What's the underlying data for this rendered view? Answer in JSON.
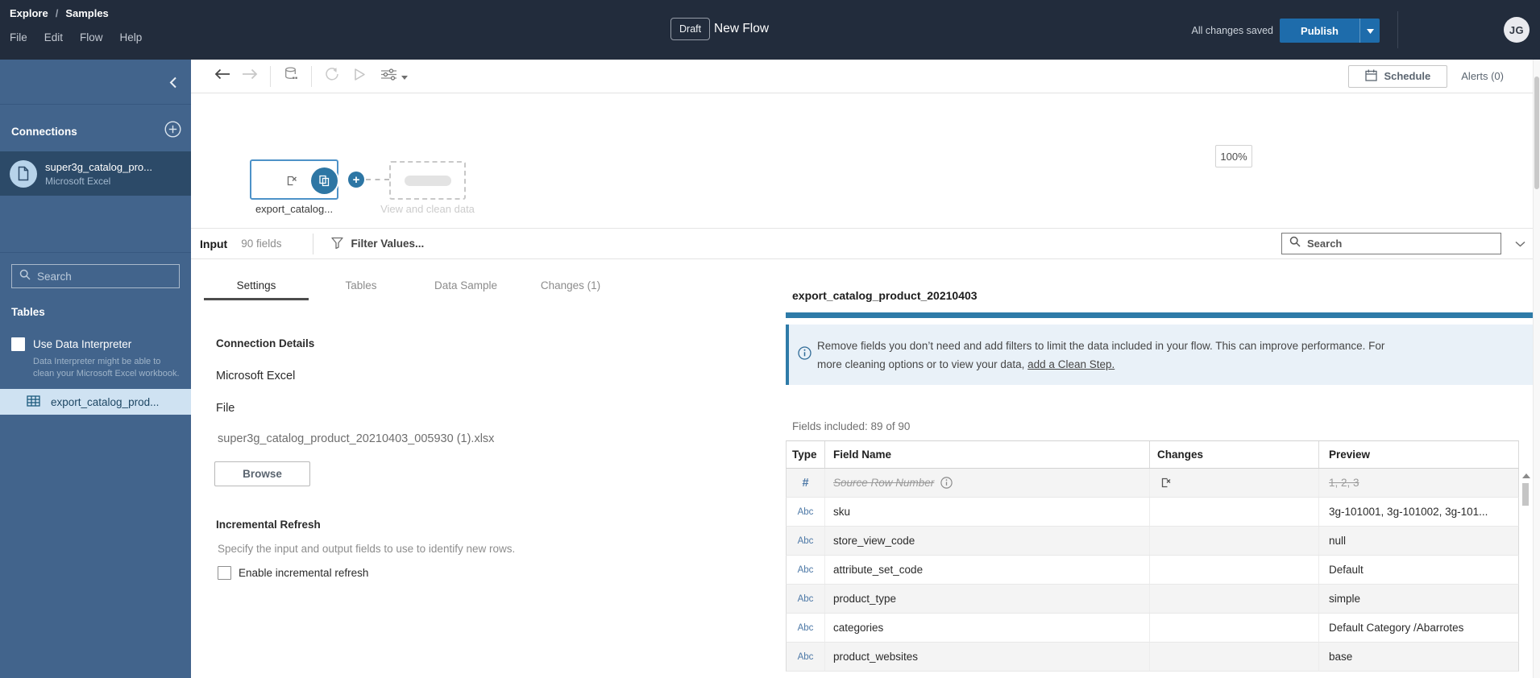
{
  "header": {
    "breadcrumb": [
      "Explore",
      "Samples"
    ],
    "breadcrumb_separator": "/",
    "menus": [
      "File",
      "Edit",
      "Flow",
      "Help"
    ],
    "draft_badge": "Draft",
    "title": "New Flow",
    "saved_status": "All changes saved",
    "publish_label": "Publish",
    "avatar_initials": "JG"
  },
  "toolbar": {
    "schedule_label": "Schedule",
    "alerts_label": "Alerts (0)"
  },
  "sidebar": {
    "connections_title": "Connections",
    "connection": {
      "name": "super3g_catalog_pro...",
      "type": "Microsoft Excel"
    },
    "search_placeholder": "Search",
    "tables_title": "Tables",
    "interpreter_label": "Use Data Interpreter",
    "interpreter_description": "Data Interpreter might be able to clean your Microsoft Excel workbook.",
    "table_item": "export_catalog_prod..."
  },
  "canvas": {
    "node_label": "export_catalog...",
    "placeholder_label": "View and clean data",
    "zoom_level": "100%"
  },
  "input_pane": {
    "title": "Input",
    "field_count": "90 fields",
    "filter_label": "Filter Values...",
    "search_placeholder": "Search"
  },
  "tabs": [
    {
      "label": "Settings",
      "active": true
    },
    {
      "label": "Tables",
      "active": false
    },
    {
      "label": "Data Sample",
      "active": false
    },
    {
      "label": "Changes (1)",
      "active": false
    }
  ],
  "settings": {
    "connection_details_title": "Connection Details",
    "connection_type": "Microsoft Excel",
    "file_label": "File",
    "file_name": "super3g_catalog_product_20210403_005930 (1).xlsx",
    "browse_label": "Browse",
    "incremental_title": "Incremental Refresh",
    "incremental_description": "Specify the input and output fields to use to identify new rows.",
    "incremental_checkbox_label": "Enable incremental refresh"
  },
  "fields_panel": {
    "title": "export_catalog_product_20210403",
    "info_line1": "Remove fields you don’t need and add filters to limit the data included in your flow. This can improve performance. For",
    "info_line2": "more cleaning options or to view your data,",
    "info_link": "add a Clean Step.",
    "fields_included": "Fields included: 89 of 90",
    "columns": [
      "Type",
      "Field Name",
      "Changes",
      "Preview"
    ],
    "rows": [
      {
        "type": "#",
        "name": "Source Row Number",
        "preview": "1, 2, 3",
        "excluded": true,
        "has_info": true,
        "has_change": true
      },
      {
        "type": "Abc",
        "name": "sku",
        "preview": "3g-101001, 3g-101002, 3g-101..."
      },
      {
        "type": "Abc",
        "name": "store_view_code",
        "preview": "null"
      },
      {
        "type": "Abc",
        "name": "attribute_set_code",
        "preview": "Default"
      },
      {
        "type": "Abc",
        "name": "product_type",
        "preview": "simple"
      },
      {
        "type": "Abc",
        "name": "categories",
        "preview": "Default Category /Abarrotes"
      },
      {
        "type": "Abc",
        "name": "product_websites",
        "preview": "base"
      }
    ]
  },
  "colors": {
    "header_bg": "#222c3c",
    "sidebar_bg": "#42648c",
    "sidebar_selected_bg": "#2c4a68",
    "table_item_selected_bg": "#cfe2f2",
    "publish_blue": "#1e6cab",
    "step_blue": "#2d76a4",
    "node_border_blue": "#4d92c8",
    "info_accent_blue": "#2e7ba8",
    "info_bg": "#e9f1f8",
    "field_type_blue": "#4e79a7"
  }
}
